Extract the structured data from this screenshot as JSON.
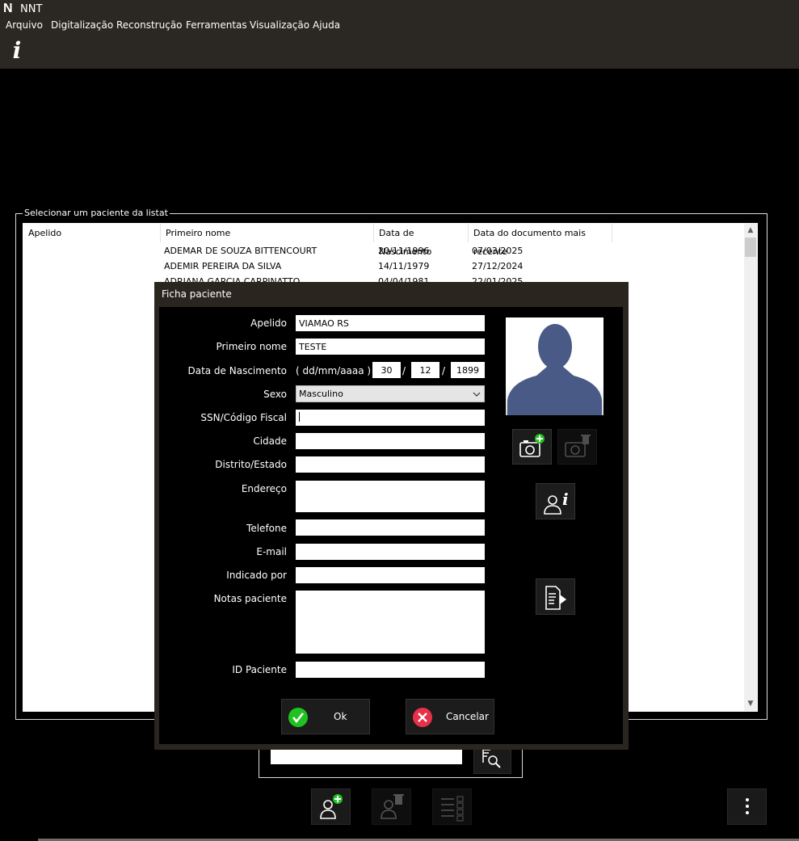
{
  "app": {
    "logo": "N",
    "title": "NNT"
  },
  "menu": [
    "Arquivo",
    "Digitalização",
    "Reconstrução",
    "Ferramentas",
    "Visualização",
    "Ajuda"
  ],
  "toolbar": {
    "info_icon": "i"
  },
  "patient_list": {
    "group_label": "Selecionar um paciente da listat",
    "columns": [
      "Apelido",
      "Primeiro nome",
      "Data de Nascimento",
      "Data do documento mais recente"
    ],
    "rows": [
      [
        "",
        "ADEMAR DE SOUZA BITTENCOURT",
        "20/11/1996",
        "07/03/2025"
      ],
      [
        "",
        "ADEMIR PEREIRA DA SILVA",
        "14/11/1979",
        "27/12/2024"
      ],
      [
        "",
        "ADRIANA GARCIA CARPINATTO",
        "04/04/1981",
        "22/01/2025"
      ]
    ]
  },
  "dialog": {
    "title": "Ficha paciente",
    "labels": {
      "apelido": "Apelido",
      "primeiro_nome": "Primeiro nome",
      "data_nascimento": "Data de Nascimento",
      "date_format": "( dd/mm/aaaa )",
      "sexo": "Sexo",
      "ssn": "SSN/Código Fiscal",
      "cidade": "Cidade",
      "distrito": "Distrito/Estado",
      "endereco": "Endereço",
      "telefone": "Telefone",
      "email": "E-mail",
      "indicado": "Indicado por",
      "notas": "Notas paciente",
      "id": "ID Paciente"
    },
    "values": {
      "apelido": "VIAMAO RS",
      "primeiro_nome": "TESTE",
      "day": "30",
      "month": "12",
      "year": "1899",
      "sexo": "Masculino",
      "ssn": "",
      "cidade": "",
      "distrito": "",
      "endereco": "",
      "telefone": "",
      "email": "",
      "indicado": "",
      "notas": "",
      "id": ""
    },
    "date_sep": "/",
    "ok_label": "Ok",
    "cancel_label": "Cancelar"
  },
  "search": {
    "value": ""
  },
  "colors": {
    "titlebar": "#2b2723",
    "ok_green": "#1fc21f",
    "cancel_red": "#e8304a",
    "avatar_blue": "#4a5a86"
  }
}
